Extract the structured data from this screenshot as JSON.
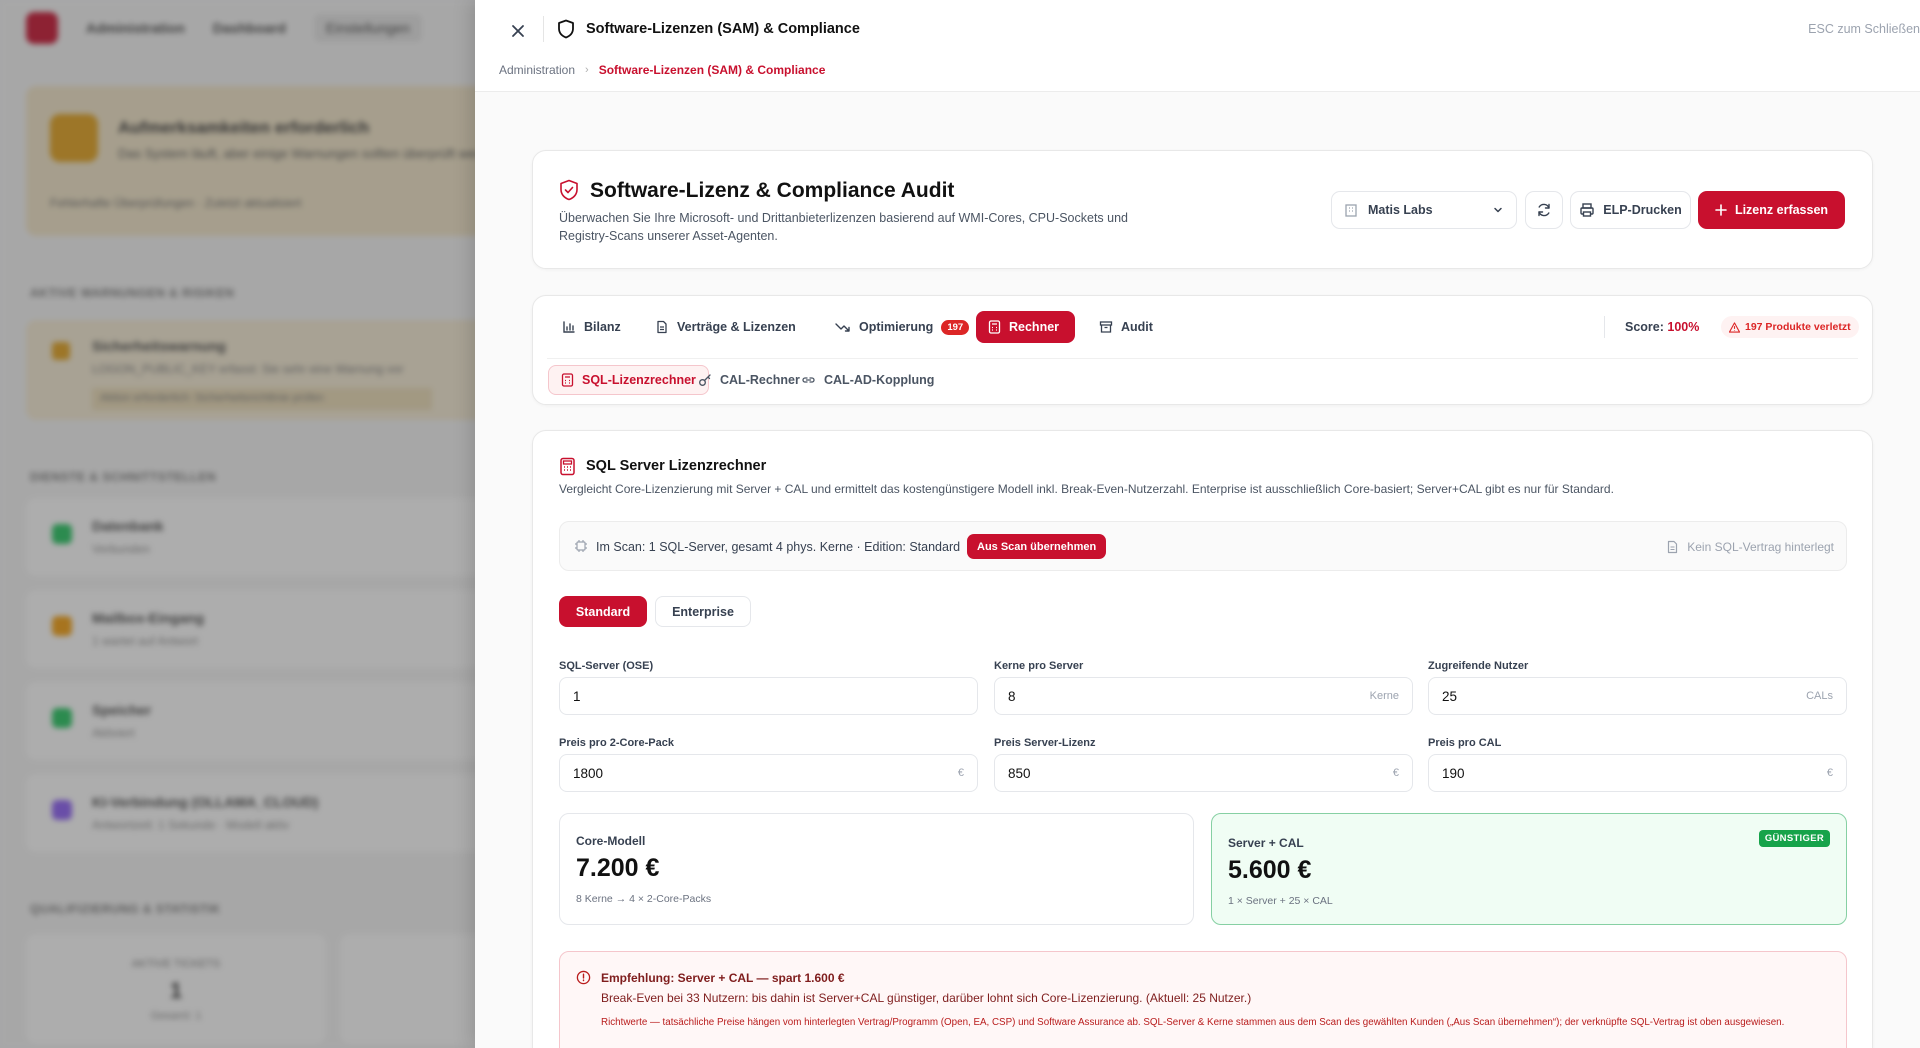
{
  "background": {
    "nav": [
      "Administration",
      "Dashboard",
      "Einstellungen"
    ],
    "alert_title": "Aufmerksamkeiten erforderlich",
    "alert_text": "Das System läuft, aber einige Warnungen sollten überprüft werden.",
    "alert_meta": "Fehlerhafte Überprüfungen · Zuletzt aktualisiert",
    "section_1": "AKTIVE WARNUNGEN & RISIKEN",
    "warning_title": "Sicherheitswarnung",
    "warning_text": "LOGON_PUBLIC_KEY erfasst: Sie sehr eine Warnung vor",
    "warning_action": "Aktion erforderlich: Sicherheitsrichtlinie prüfen",
    "section_2": "DIENSTE & SCHNITTSTELLEN",
    "rows": [
      {
        "title": "Datenbank",
        "sub": "Verbunden"
      },
      {
        "title": "Mailbox-Eingang",
        "sub": "1 wartet auf Antwort"
      },
      {
        "title": "Speicher",
        "sub": "Aktiviert"
      },
      {
        "title": "KI-Verbindung (OLLAMA_CLOUD)",
        "sub": "Antwortzeit: 1 Sekunde · Modell aktiv"
      }
    ],
    "section_3": "QUALIFIZIERUNG & STATISTIK",
    "tile_label": "AKTIVE TICKETS",
    "tile_value": "1",
    "tile_sub": "Gesamt: 1"
  },
  "panel": {
    "title": "Software-Lizenzen (SAM) & Compliance",
    "esc_hint": "ESC zum Schließen",
    "breadcrumb": [
      "Administration",
      "Software-Lizenzen (SAM) & Compliance"
    ]
  },
  "header": {
    "title": "Software-Lizenz & Compliance Audit",
    "description": "Überwachen Sie Ihre Microsoft- und Drittanbieterlizenzen basierend auf WMI-Cores, CPU-Sockets und Registry-Scans unserer Asset-Agenten.",
    "client": "Matis Labs",
    "print_label": "ELP-Drucken",
    "add_label": "Lizenz erfassen"
  },
  "tabs": {
    "items": [
      {
        "label": "Bilanz"
      },
      {
        "label": "Verträge & Lizenzen"
      },
      {
        "label": "Optimierung",
        "badge": "197"
      },
      {
        "label": "Rechner"
      },
      {
        "label": "Audit"
      }
    ],
    "score_label": "Score:",
    "score_value": "100%",
    "violation": "197 Produkte verletzt",
    "subtabs": [
      "SQL-Lizenzrechner",
      "CAL-Rechner",
      "CAL-AD-Kopplung"
    ]
  },
  "calculator": {
    "title": "SQL Server Lizenzrechner",
    "description": "Vergleicht Core-Lizenzierung mit Server + CAL und ermittelt das kostengünstigere Modell inkl. Break-Even-Nutzerzahl. Enterprise ist ausschließlich Core-basiert; Server+CAL gibt es nur für Standard.",
    "scan_text": "Im Scan: 1 SQL-Server, gesamt 4 phys. Kerne · Edition: Standard",
    "scan_button": "Aus Scan übernehmen",
    "contract_text": "Kein SQL-Vertrag hinterlegt",
    "edition_standard": "Standard",
    "edition_enterprise": "Enterprise",
    "fields": {
      "sql_servers": {
        "label": "SQL-Server (OSE)",
        "value": "1",
        "unit": ""
      },
      "cores_per_server": {
        "label": "Kerne pro Server",
        "value": "8",
        "unit": "Kerne"
      },
      "users": {
        "label": "Zugreifende Nutzer",
        "value": "25",
        "unit": "CALs"
      },
      "price_core_pack": {
        "label": "Preis pro 2-Core-Pack",
        "value": "1800",
        "unit": "€"
      },
      "price_server": {
        "label": "Preis Server-Lizenz",
        "value": "850",
        "unit": "€"
      },
      "price_cal": {
        "label": "Preis pro CAL",
        "value": "190",
        "unit": "€"
      }
    },
    "core_model": {
      "label": "Core-Modell",
      "value": "7.200 €",
      "detail": "8 Kerne → 4 × 2-Core-Packs"
    },
    "server_cal": {
      "label": "Server + CAL",
      "value": "5.600 €",
      "detail": "1 × Server + 25 × CAL",
      "badge": "GÜNSTIGER"
    },
    "recommendation": {
      "title": "Empfehlung: Server + CAL — spart 1.600 €",
      "text": "Break-Even bei 33 Nutzern: bis dahin ist Server+CAL günstiger, darüber lohnt sich Core-Lizenzierung. (Aktuell: 25 Nutzer.)",
      "note": "Richtwerte — tatsächliche Preise hängen vom hinterlegten Vertrag/Programm (Open, EA, CSP) und Software Assurance ab. SQL-Server & Kerne stammen aus dem Scan des gewählten Kunden („Aus Scan übernehmen“); der verknüpfte SQL-Vertrag ist oben ausgewiesen."
    }
  }
}
